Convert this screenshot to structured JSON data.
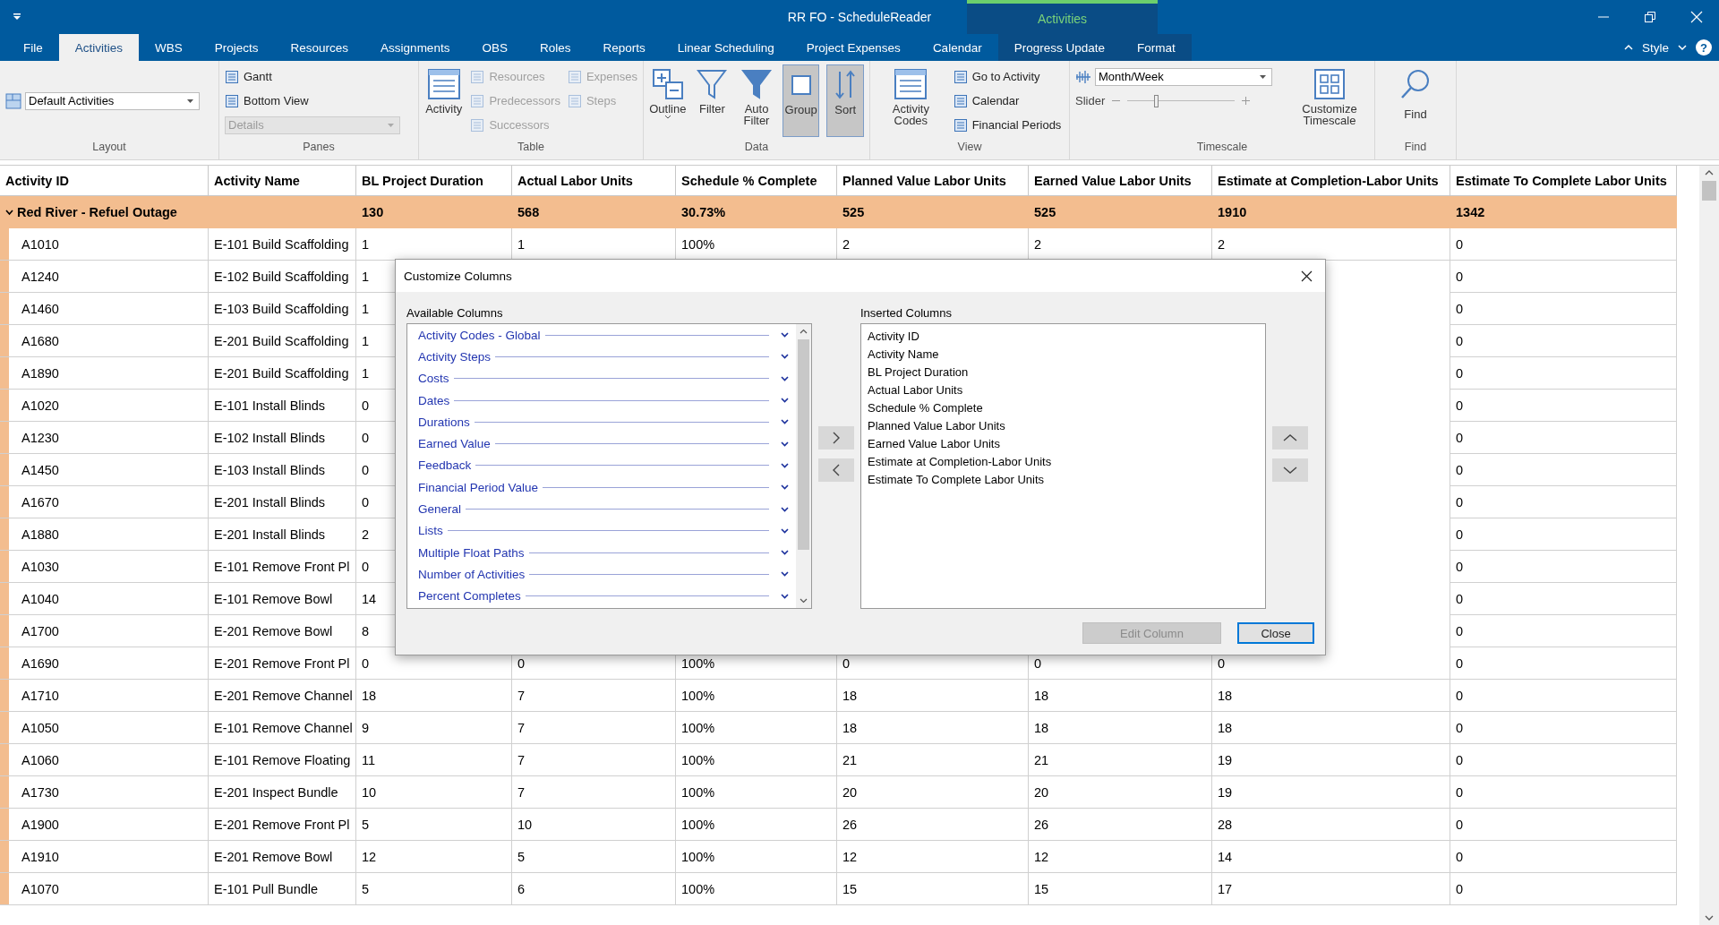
{
  "window": {
    "title": "RR FO - ScheduleReader",
    "contextual_label": "Activities"
  },
  "tabs": [
    {
      "label": "File",
      "selected": false,
      "contextual": false
    },
    {
      "label": "Activities",
      "selected": true,
      "contextual": false
    },
    {
      "label": "WBS",
      "selected": false,
      "contextual": false
    },
    {
      "label": "Projects",
      "selected": false,
      "contextual": false
    },
    {
      "label": "Resources",
      "selected": false,
      "contextual": false
    },
    {
      "label": "Assignments",
      "selected": false,
      "contextual": false
    },
    {
      "label": "OBS",
      "selected": false,
      "contextual": false
    },
    {
      "label": "Roles",
      "selected": false,
      "contextual": false
    },
    {
      "label": "Reports",
      "selected": false,
      "contextual": false
    },
    {
      "label": "Linear Scheduling",
      "selected": false,
      "contextual": false
    },
    {
      "label": "Project Expenses",
      "selected": false,
      "contextual": false
    },
    {
      "label": "Calendar",
      "selected": false,
      "contextual": false
    },
    {
      "label": "Progress Update",
      "selected": false,
      "contextual": true
    },
    {
      "label": "Format",
      "selected": false,
      "contextual": true
    }
  ],
  "style_menu": {
    "label": "Style",
    "help": "?"
  },
  "ribbon": [
    {
      "label": "Layout",
      "kind": "layout",
      "items": [
        {
          "kind": "dropdown",
          "label": "Default Activities",
          "disabled": false
        }
      ]
    },
    {
      "label": "Panes",
      "kind": "panes",
      "items": [
        {
          "kind": "small",
          "label": "Gantt",
          "disabled": false
        },
        {
          "kind": "small",
          "label": "Bottom View",
          "disabled": false
        },
        {
          "kind": "dropdown",
          "label": "Details",
          "disabled": true
        }
      ]
    },
    {
      "label": "Table",
      "kind": "table",
      "items": [
        {
          "kind": "large",
          "label": "Activity",
          "pressed": false
        },
        {
          "kind": "small",
          "label": "Resources",
          "disabled": true
        },
        {
          "kind": "small",
          "label": "Predecessors",
          "disabled": true
        },
        {
          "kind": "small",
          "label": "Successors",
          "disabled": true
        },
        {
          "kind": "small",
          "label": "Expenses",
          "disabled": true
        },
        {
          "kind": "small",
          "label": "Steps",
          "disabled": true
        }
      ]
    },
    {
      "label": "Data",
      "kind": "data",
      "items": [
        {
          "kind": "large",
          "label": "Outline",
          "pressed": false,
          "menu": true
        },
        {
          "kind": "large",
          "label": "Filter",
          "pressed": false
        },
        {
          "kind": "large",
          "label": "Auto Filter",
          "pressed": false
        },
        {
          "kind": "large",
          "label": "Group",
          "pressed": true
        },
        {
          "kind": "large",
          "label": "Sort",
          "pressed": true
        }
      ]
    },
    {
      "label": "View",
      "kind": "view",
      "items": [
        {
          "kind": "large",
          "label": "Activity Codes",
          "pressed": false
        },
        {
          "kind": "small",
          "label": "Go to Activity",
          "disabled": false
        },
        {
          "kind": "small",
          "label": "Calendar",
          "disabled": false
        },
        {
          "kind": "small",
          "label": "Financial Periods",
          "disabled": false
        }
      ]
    },
    {
      "label": "Timescale",
      "kind": "timescale",
      "items": [
        {
          "kind": "dropdown",
          "label": "Month/Week",
          "disabled": false
        },
        {
          "kind": "slider",
          "label": "Slider",
          "level": 0.25
        },
        {
          "kind": "large",
          "label": "Customize Timescale",
          "pressed": false
        }
      ]
    },
    {
      "label": "Find",
      "kind": "find",
      "items": [
        {
          "kind": "large",
          "label": "Find",
          "pressed": false
        }
      ]
    }
  ],
  "table": {
    "columns": [
      "Activity ID",
      "Activity Name",
      "BL Project Duration",
      "Actual Labor Units",
      "Schedule % Complete",
      "Planned Value Labor Units",
      "Earned Value Labor Units",
      "Estimate at Completion-Labor Units",
      "Estimate To Complete Labor Units"
    ],
    "group": {
      "name": "Red River - Refuel Outage",
      "expanded": true,
      "values": [
        "130",
        "568",
        "30.73%",
        "525",
        "525",
        "1910",
        "1342"
      ]
    },
    "rows": [
      [
        "A1010",
        "E-101 Build Scaffolding",
        "1",
        "1",
        "100%",
        "2",
        "2",
        "2",
        "0"
      ],
      [
        "A1240",
        "E-102 Build Scaffolding",
        "1",
        null,
        null,
        null,
        null,
        null,
        "0"
      ],
      [
        "A1460",
        "E-103 Build Scaffolding",
        "1",
        null,
        null,
        null,
        null,
        null,
        "0"
      ],
      [
        "A1680",
        "E-201 Build Scaffolding",
        "1",
        null,
        null,
        null,
        null,
        null,
        "0"
      ],
      [
        "A1890",
        "E-201 Build Scaffolding",
        "1",
        null,
        null,
        null,
        null,
        null,
        "0"
      ],
      [
        "A1020",
        "E-101 Install Blinds",
        "0",
        null,
        null,
        null,
        null,
        null,
        "0"
      ],
      [
        "A1230",
        "E-102 Install Blinds",
        "0",
        null,
        null,
        null,
        null,
        null,
        "0"
      ],
      [
        "A1450",
        "E-103 Install Blinds",
        "0",
        null,
        null,
        null,
        null,
        null,
        "0"
      ],
      [
        "A1670",
        "E-201 Install Blinds",
        "0",
        null,
        null,
        null,
        null,
        null,
        "0"
      ],
      [
        "A1880",
        "E-201 Install Blinds",
        "2",
        null,
        null,
        null,
        null,
        null,
        "0"
      ],
      [
        "A1030",
        "E-101 Remove Front Pl",
        "0",
        null,
        null,
        null,
        null,
        null,
        "0"
      ],
      [
        "A1040",
        "E-101 Remove Bowl",
        "14",
        null,
        null,
        null,
        null,
        null,
        "0"
      ],
      [
        "A1700",
        "E-201 Remove Bowl",
        "8",
        null,
        null,
        null,
        null,
        null,
        "0"
      ],
      [
        "A1690",
        "E-201 Remove Front Pl",
        "0",
        "0",
        "100%",
        "0",
        "0",
        "0",
        "0"
      ],
      [
        "A1710",
        "E-201 Remove Channel",
        "18",
        "7",
        "100%",
        "18",
        "18",
        "18",
        "0"
      ],
      [
        "A1050",
        "E-101 Remove Channel",
        "9",
        "7",
        "100%",
        "18",
        "18",
        "18",
        "0"
      ],
      [
        "A1060",
        "E-101 Remove Floating",
        "11",
        "7",
        "100%",
        "21",
        "21",
        "19",
        "0"
      ],
      [
        "A1730",
        "E-201 Inspect Bundle",
        "10",
        "7",
        "100%",
        "20",
        "20",
        "19",
        "0"
      ],
      [
        "A1900",
        "E-201 Remove Front Pl",
        "5",
        "10",
        "100%",
        "26",
        "26",
        "28",
        "0"
      ],
      [
        "A1910",
        "E-201 Remove Bowl",
        "12",
        "5",
        "100%",
        "12",
        "12",
        "14",
        "0"
      ],
      [
        "A1070",
        "E-101 Pull Bundle",
        "5",
        "6",
        "100%",
        "15",
        "15",
        "17",
        "0"
      ]
    ]
  },
  "dialog": {
    "title": "Customize Columns",
    "available_label": "Available Columns",
    "available": [
      "Activity Codes - Global",
      "Activity Steps",
      "Costs",
      "Dates",
      "Durations",
      "Earned Value",
      "Feedback",
      "Financial Period Value",
      "General",
      "Lists",
      "Multiple Float Paths",
      "Number of Activities",
      "Percent Completes"
    ],
    "inserted_label": "Inserted Columns",
    "inserted": [
      "Activity ID",
      "Activity Name",
      "BL Project Duration",
      "Actual Labor Units",
      "Schedule % Complete",
      "Planned Value Labor Units",
      "Earned Value Labor Units",
      "Estimate at Completion-Labor Units",
      "Estimate To Complete Labor Units"
    ],
    "buttons": [
      {
        "label": "Edit Column",
        "disabled": true,
        "default": false
      },
      {
        "label": "Close",
        "disabled": false,
        "default": true
      }
    ]
  }
}
